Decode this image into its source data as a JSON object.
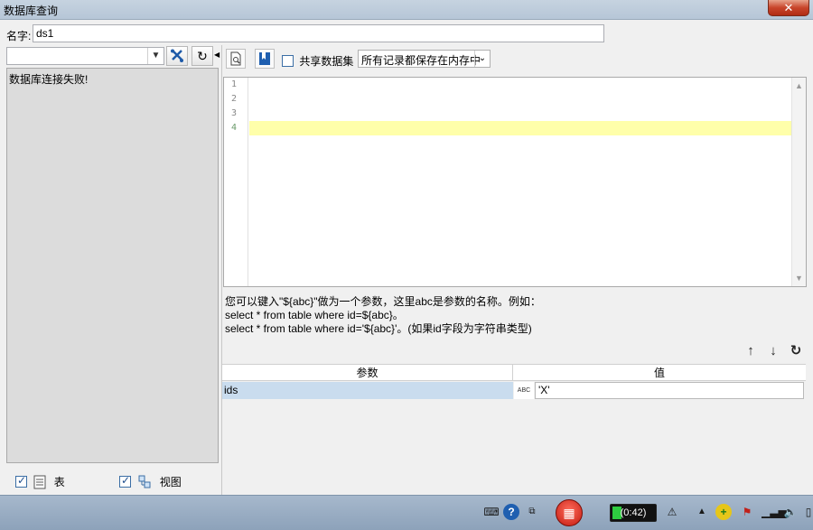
{
  "window": {
    "title": "数据库查询",
    "close_label": "✕"
  },
  "name_field": {
    "label": "名字:",
    "value": "ds1"
  },
  "left": {
    "connection_select_value": "",
    "message": "数据库连接失败!",
    "show_tables": {
      "label": "表",
      "checked": true
    },
    "show_views": {
      "label": "视图",
      "checked": true
    }
  },
  "toolbar": {
    "shared_dataset_label": "共享数据集",
    "memory_mode_value": "所有记录都保存在内存中"
  },
  "editor": {
    "line_numbers": [
      "1",
      "2",
      "3",
      "4"
    ],
    "current_line": 4
  },
  "hint": {
    "line1": "您可以键入\"${abc}\"做为一个参数，这里abc是参数的名称。例如：",
    "line2": "select * from table where id=${abc}。",
    "line3": "select * from table where id='${abc}'。(如果id字段为字符串类型)"
  },
  "params": {
    "col_param": "参数",
    "col_value": "值",
    "rows": [
      {
        "name": "ids",
        "type_label": "ABC",
        "value": "'X'"
      }
    ]
  },
  "taskbar": {
    "battery_time": "(0:42)"
  },
  "colors": {
    "highlight_line": "#ffffaa",
    "selected_row": "#c9dcee",
    "tree_bg": "#dcdcdc"
  }
}
